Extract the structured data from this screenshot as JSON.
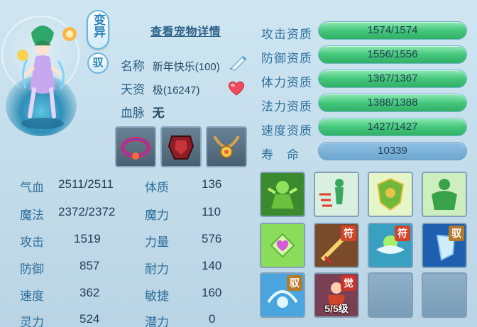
{
  "header": {
    "mutant_badge": "变异",
    "ride_badge": "驭",
    "details_link": "查看宠物详情"
  },
  "info": {
    "name_label": "名称",
    "name_value": "新年快乐(100)",
    "talent_label": "天资",
    "talent_value": "极(16247)",
    "bloodline_label": "血脉",
    "bloodline_value": "无"
  },
  "stats_left": [
    {
      "label": "气血",
      "value": "2511/2511"
    },
    {
      "label": "魔法",
      "value": "2372/2372"
    },
    {
      "label": "攻击",
      "value": "1519"
    },
    {
      "label": "防御",
      "value": "857"
    },
    {
      "label": "速度",
      "value": "362"
    },
    {
      "label": "灵力",
      "value": "524"
    }
  ],
  "stats_right": [
    {
      "label": "体质",
      "value": "136"
    },
    {
      "label": "魔力",
      "value": "110"
    },
    {
      "label": "力量",
      "value": "576"
    },
    {
      "label": "耐力",
      "value": "140"
    },
    {
      "label": "敏捷",
      "value": "160"
    },
    {
      "label": "潜力",
      "value": "0"
    }
  ],
  "aptitudes": [
    {
      "label": "攻击资质",
      "value": "1574/1574"
    },
    {
      "label": "防御资质",
      "value": "1556/1556"
    },
    {
      "label": "体力资质",
      "value": "1367/1367"
    },
    {
      "label": "法力资质",
      "value": "1388/1388"
    },
    {
      "label": "速度资质",
      "value": "1427/1427"
    }
  ],
  "lifespan": {
    "label": "寿　命",
    "value": "10339"
  },
  "skills": {
    "tag_fu": "符",
    "tag_yu": "驭",
    "tag_jue": "觉",
    "awaken_level": "5/5级"
  },
  "colors": {
    "accent": "#2a82bd",
    "bar_green": "#45c77c",
    "bar_blue": "#6ea6cf"
  }
}
